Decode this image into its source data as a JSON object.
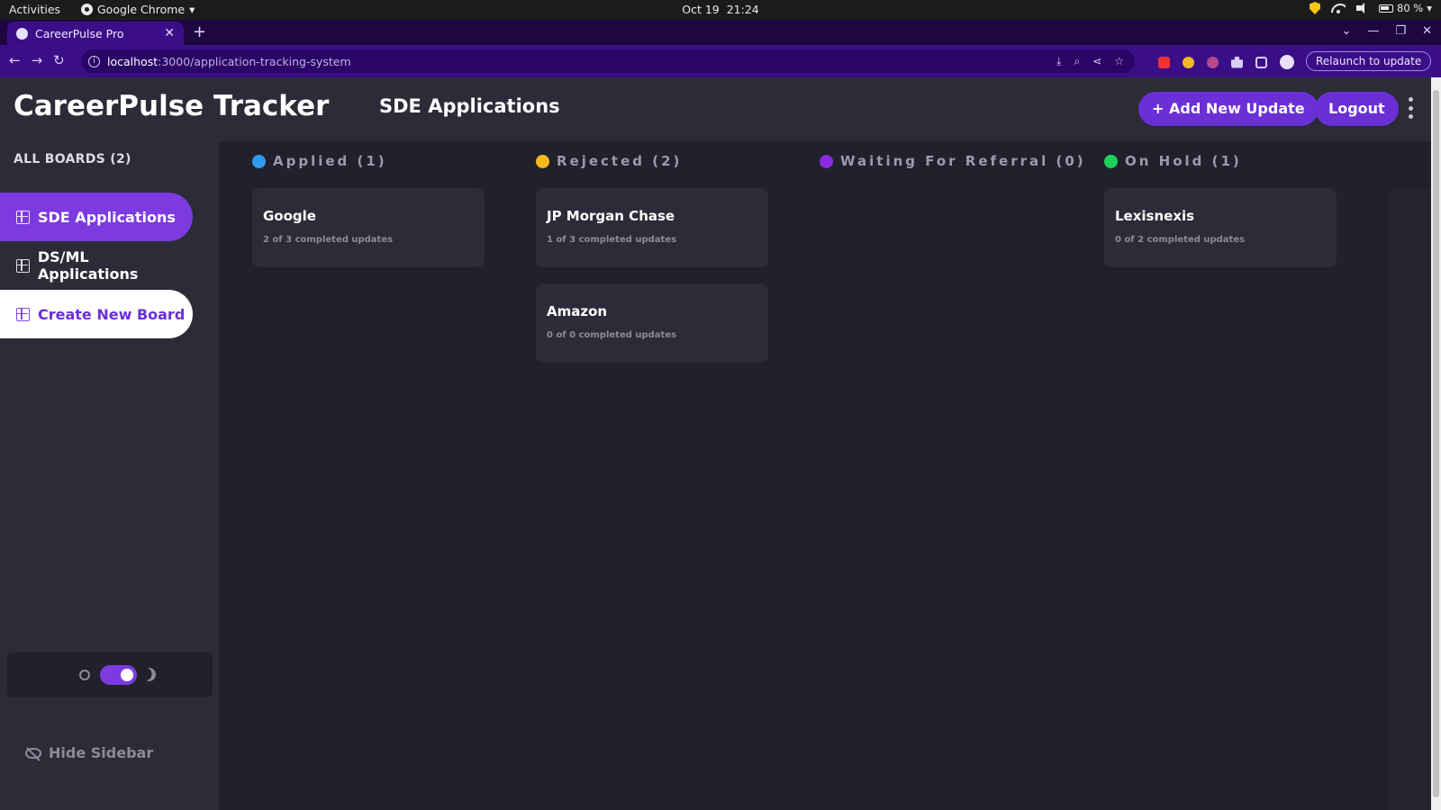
{
  "os": {
    "activities": "Activities",
    "app_name": "Google Chrome",
    "date": "Oct 19",
    "time": "21:24",
    "battery": "80 %"
  },
  "browser": {
    "tab_title": "CareerPulse Pro",
    "url_host": "localhost",
    "url_path": ":3000/application-tracking-system",
    "relaunch_label": "Relaunch to update"
  },
  "header": {
    "brand": "CareerPulse Tracker",
    "board_title": "SDE Applications",
    "add_button": "+ Add New Update",
    "logout_button": "Logout"
  },
  "sidebar": {
    "heading": "ALL BOARDS (2)",
    "items": [
      {
        "label": "SDE Applications",
        "active": true
      },
      {
        "label": "DS/ML Applications",
        "active": false
      }
    ],
    "create_label": "Create New Board",
    "hide_label": "Hide Sidebar",
    "dark_mode": true
  },
  "columns": [
    {
      "title": "Applied (1)",
      "color": "#2d9cf0",
      "cards": [
        {
          "title": "Google",
          "subtitle": "2 of 3 completed updates"
        }
      ]
    },
    {
      "title": "Rejected (2)",
      "color": "#f5b81c",
      "cards": [
        {
          "title": "JP Morgan Chase",
          "subtitle": "1 of 3 completed updates"
        },
        {
          "title": "Amazon",
          "subtitle": "0 of 0 completed updates"
        }
      ]
    },
    {
      "title": "Waiting For Referral (0)",
      "color": "#8a2be2",
      "cards": []
    },
    {
      "title": "On Hold (1)",
      "color": "#1ed15a",
      "cards": [
        {
          "title": "Lexisnexis",
          "subtitle": "0 of 2 completed updates"
        }
      ]
    }
  ],
  "colors": {
    "accent": "#7c3ae0",
    "chrome_frame": "#3a0e87",
    "app_bg": "#20212c",
    "panel_bg": "#2b2c37"
  }
}
